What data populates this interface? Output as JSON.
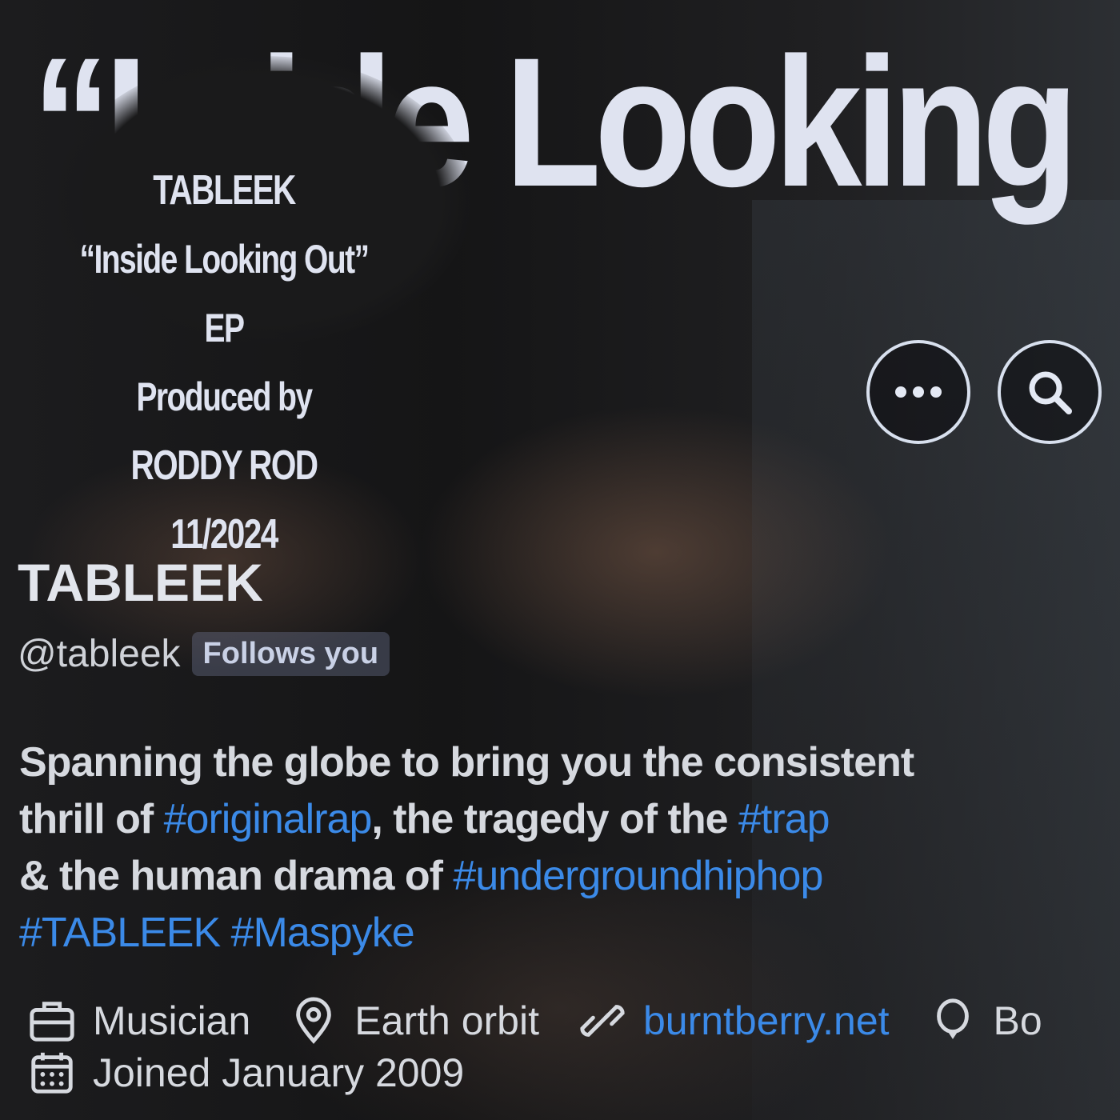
{
  "banner": {
    "title": "“I   side Looking",
    "ep_lines": [
      "TABLEEK",
      "“Inside Looking Out” EP",
      "Produced by",
      "RODDY ROD",
      "11/2024"
    ]
  },
  "actions": {
    "more_icon": "more-horizontal-icon",
    "search_icon": "search-icon"
  },
  "profile": {
    "display_name": "TABLEEK",
    "handle": "@tableek",
    "follows_badge": "Follows you",
    "bio": {
      "line1": "Spanning the globe to bring you the consistent",
      "line2_pre": "thrill of ",
      "tag_originalrap": "#originalrap",
      "line2_mid": ", the tragedy of the ",
      "tag_trap": "#trap",
      "line3_pre": "& the human drama of ",
      "tag_underground": "#undergroundhiphop",
      "tag_tableek": "#TABLEEK",
      "tag_maspyke": "#Maspyke"
    },
    "meta": {
      "category": "Musician",
      "location": "Earth orbit",
      "website": "burntberry.net",
      "birthday_partial": "Bo",
      "joined": "Joined January 2009"
    }
  },
  "colors": {
    "link": "#3b8ae8",
    "text": "#d6d9df",
    "banner_text": "#dfe3f0"
  }
}
